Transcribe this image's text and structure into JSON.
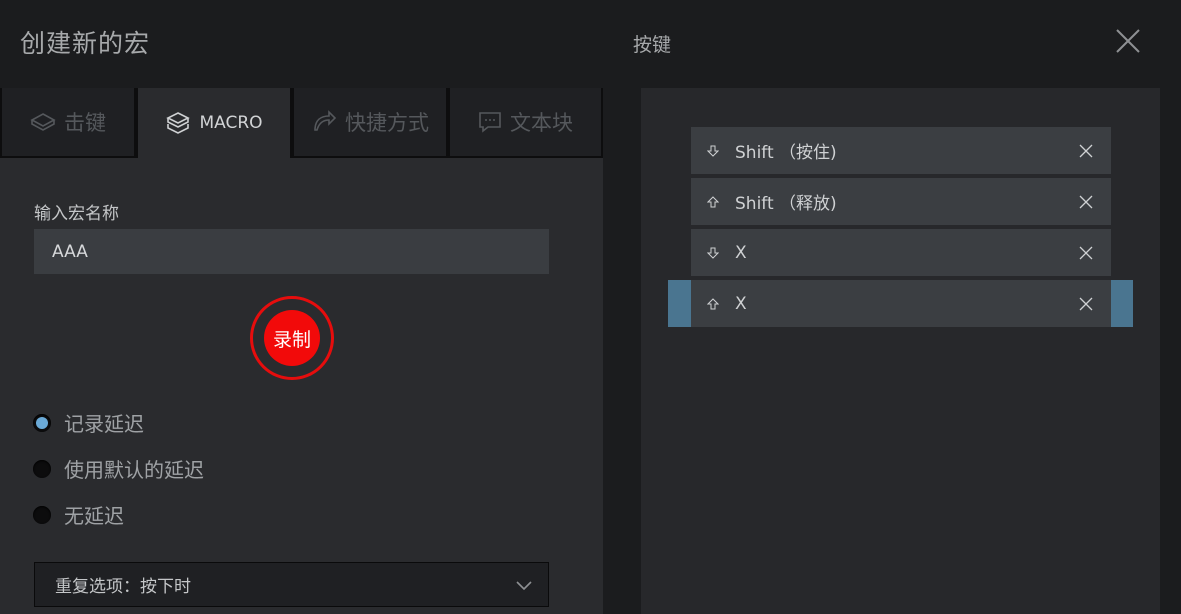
{
  "window": {
    "title": "创建新的宏",
    "keys_title": "按键"
  },
  "tabs": [
    {
      "label": "击键",
      "icon": "keystroke-icon"
    },
    {
      "label": "MACRO",
      "icon": "macro-icon",
      "active": true
    },
    {
      "label": "快捷方式",
      "icon": "shortcut-icon"
    },
    {
      "label": "文本块",
      "icon": "text-block-icon"
    }
  ],
  "form": {
    "name_label": "输入宏名称",
    "name_value": "AAA",
    "record_label": "录制",
    "delay_options": [
      {
        "label": "记录延迟",
        "selected": true
      },
      {
        "label": "使用默认的延迟",
        "selected": false
      },
      {
        "label": "无延迟",
        "selected": false
      }
    ],
    "repeat_label": "重复选项：按下时"
  },
  "keys": [
    {
      "label": "Shift （按住)",
      "direction": "down"
    },
    {
      "label": "Shift （释放)",
      "direction": "up"
    },
    {
      "label": "X",
      "direction": "down"
    },
    {
      "label": "X",
      "direction": "up",
      "selected": true
    }
  ],
  "colors": {
    "accent": "#6aa9d6",
    "record": "#f20a0a",
    "selected": "#4a7590"
  }
}
